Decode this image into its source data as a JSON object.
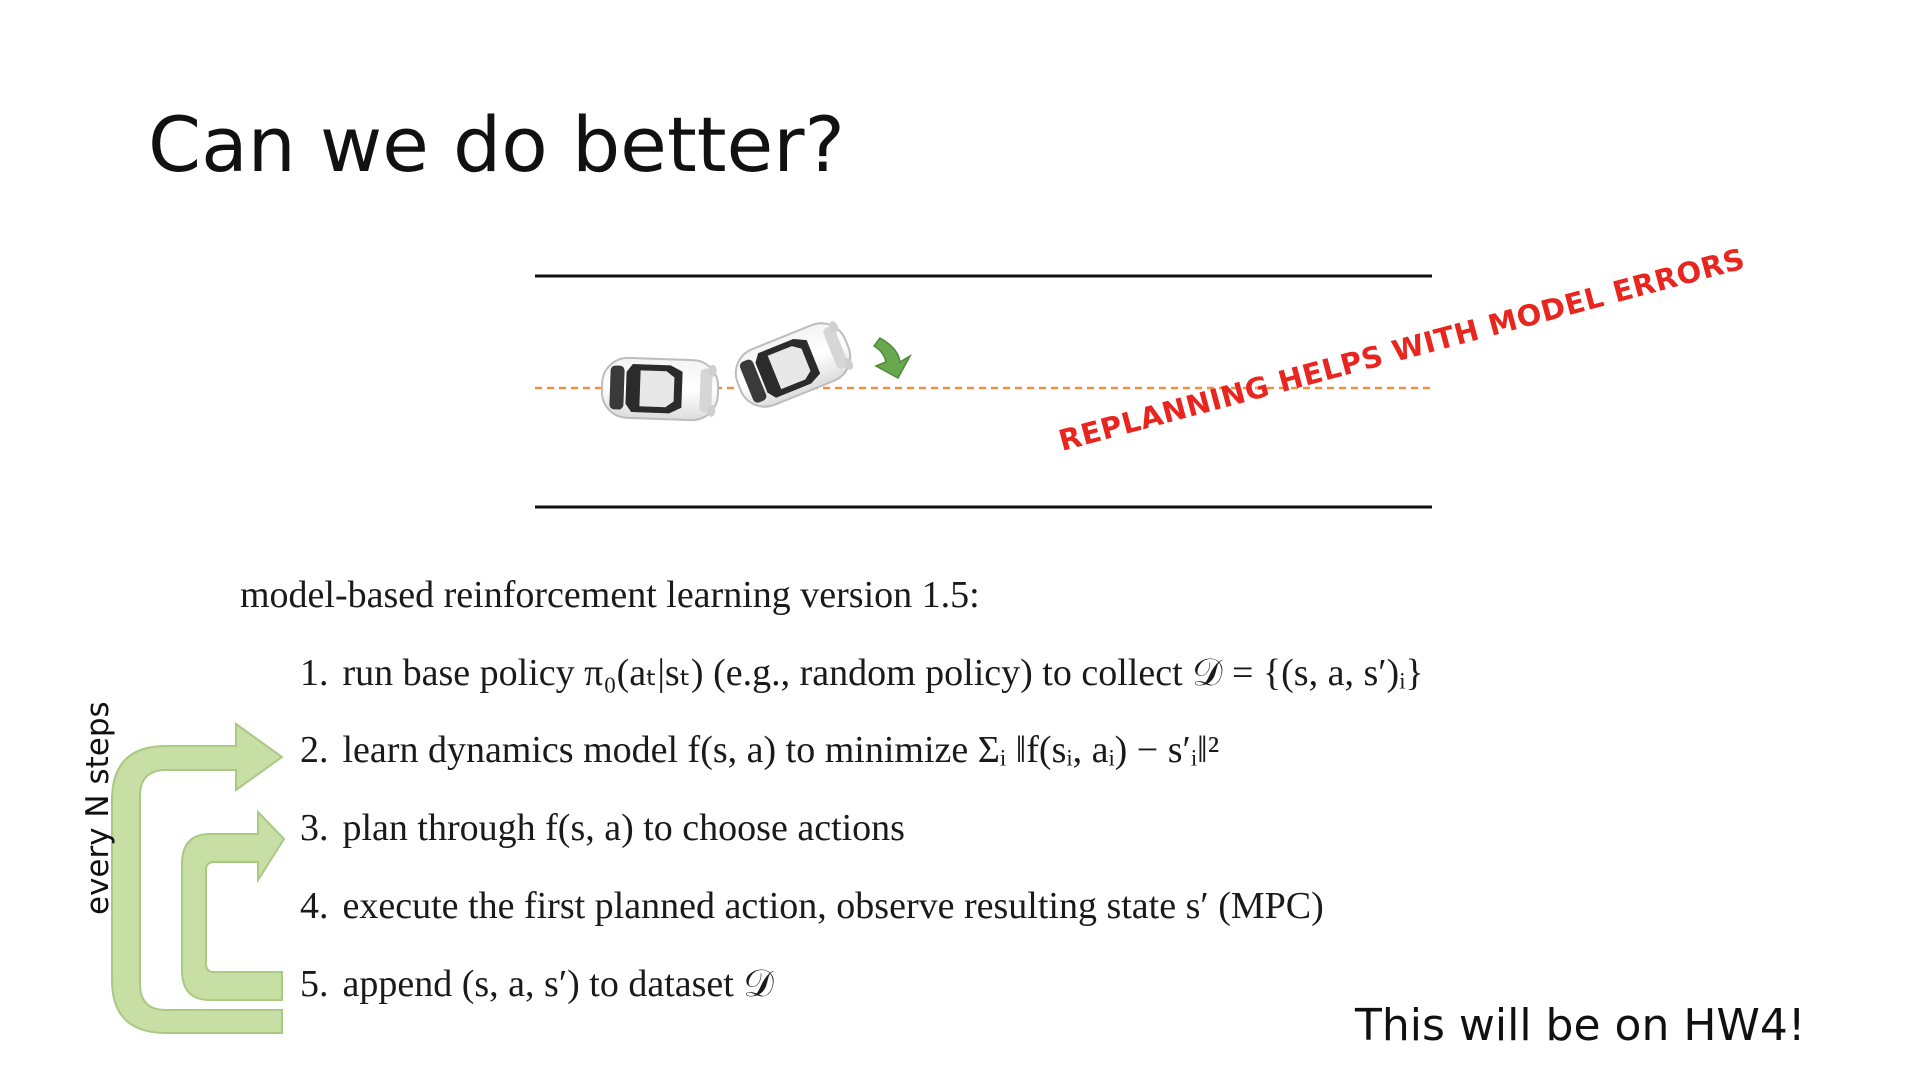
{
  "slide": {
    "title": "Can we do better?",
    "annotation": "REPLANNING HELPS WITH MODEL ERRORS",
    "footnote": "This will be on HW4!",
    "loop_label": "every N steps"
  },
  "algorithm": {
    "title": "model-based reinforcement learning version 1.5:",
    "steps": [
      {
        "num": "1.",
        "text": "run base policy π₀(aₜ|sₜ) (e.g., random policy) to collect 𝒟 = {(s, a, s′)ᵢ}"
      },
      {
        "num": "2.",
        "text": "learn dynamics model f(s, a) to minimize Σᵢ ‖f(sᵢ, aᵢ) − s′ᵢ‖²"
      },
      {
        "num": "3.",
        "text": "plan through f(s, a) to choose actions"
      },
      {
        "num": "4.",
        "text": "execute the first planned action, observe resulting state s′ (MPC)"
      },
      {
        "num": "5.",
        "text": "append (s, a, s′) to dataset 𝒟"
      }
    ]
  },
  "colors": {
    "annotation": "#e8261f",
    "lane_dash": "#f2913d",
    "arrow_green": "#b5d48e",
    "turn_arrow": "#6aa84f",
    "road_edge": "#111111"
  },
  "icons": {
    "car": "car-icon",
    "turn_arrow": "curved-arrow-icon",
    "loop_arrow": "loop-arrow-icon"
  }
}
